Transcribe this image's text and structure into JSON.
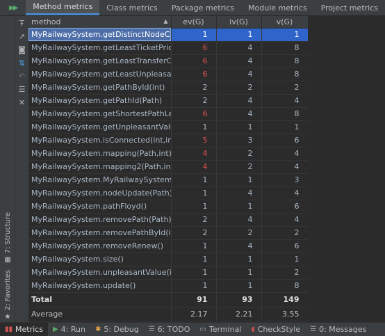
{
  "tabs": [
    {
      "label": "Method metrics",
      "active": true
    },
    {
      "label": "Class metrics",
      "active": false
    },
    {
      "label": "Package metrics",
      "active": false
    },
    {
      "label": "Module metrics",
      "active": false
    },
    {
      "label": "Project metrics",
      "active": false
    }
  ],
  "table": {
    "headers": {
      "method": "method",
      "ev": "ev(G)",
      "iv": "iv(G)",
      "v": "v(G)"
    },
    "rows": [
      {
        "method": "MyRailwaySystem.getDistinctNodeCount",
        "ev": "1",
        "iv": "1",
        "v": "1",
        "ev_red": false
      },
      {
        "method": "MyRailwaySystem.getLeastTicketPrice(int,",
        "ev": "6",
        "iv": "4",
        "v": "8",
        "ev_red": true
      },
      {
        "method": "MyRailwaySystem.getLeastTransferCount",
        "ev": "6",
        "iv": "4",
        "v": "8",
        "ev_red": true
      },
      {
        "method": "MyRailwaySystem.getLeastUnpleasantVal",
        "ev": "6",
        "iv": "4",
        "v": "8",
        "ev_red": true
      },
      {
        "method": "MyRailwaySystem.getPathById(int)",
        "ev": "2",
        "iv": "2",
        "v": "2",
        "ev_red": false
      },
      {
        "method": "MyRailwaySystem.getPathId(Path)",
        "ev": "2",
        "iv": "4",
        "v": "4",
        "ev_red": false
      },
      {
        "method": "MyRailwaySystem.getShortestPathLength",
        "ev": "6",
        "iv": "4",
        "v": "8",
        "ev_red": true
      },
      {
        "method": "MyRailwaySystem.getUnpleasantValue(Pa",
        "ev": "1",
        "iv": "1",
        "v": "1",
        "ev_red": false
      },
      {
        "method": "MyRailwaySystem.isConnected(int,int)",
        "ev": "5",
        "iv": "3",
        "v": "6",
        "ev_red": true
      },
      {
        "method": "MyRailwaySystem.mapping(Path,int)",
        "ev": "4",
        "iv": "2",
        "v": "4",
        "ev_red": true
      },
      {
        "method": "MyRailwaySystem.mapping2(Path,int)",
        "ev": "4",
        "iv": "2",
        "v": "4",
        "ev_red": true
      },
      {
        "method": "MyRailwaySystem.MyRailwaySystem()",
        "ev": "1",
        "iv": "1",
        "v": "3",
        "ev_red": false
      },
      {
        "method": "MyRailwaySystem.nodeUpdate(Path)",
        "ev": "1",
        "iv": "4",
        "v": "4",
        "ev_red": false
      },
      {
        "method": "MyRailwaySystem.pathFloyd()",
        "ev": "1",
        "iv": "1",
        "v": "6",
        "ev_red": false
      },
      {
        "method": "MyRailwaySystem.removePath(Path)",
        "ev": "2",
        "iv": "4",
        "v": "4",
        "ev_red": false
      },
      {
        "method": "MyRailwaySystem.removePathById(int)",
        "ev": "2",
        "iv": "2",
        "v": "2",
        "ev_red": false
      },
      {
        "method": "MyRailwaySystem.removeRenew()",
        "ev": "1",
        "iv": "4",
        "v": "6",
        "ev_red": false
      },
      {
        "method": "MyRailwaySystem.size()",
        "ev": "1",
        "iv": "1",
        "v": "1",
        "ev_red": false
      },
      {
        "method": "MyRailwaySystem.unpleasantValue(int,int)",
        "ev": "1",
        "iv": "1",
        "v": "2",
        "ev_red": false
      },
      {
        "method": "MyRailwaySystem.update()",
        "ev": "1",
        "iv": "1",
        "v": "8",
        "ev_red": false
      }
    ],
    "total": {
      "label": "Total",
      "ev": "91",
      "iv": "93",
      "v": "149"
    },
    "average": {
      "label": "Average",
      "ev": "2.17",
      "iv": "2.21",
      "v": "3.55"
    }
  },
  "left_stripe": {
    "structure": "7: Structure",
    "favorites": "2: Favorites"
  },
  "bottom_tools": [
    {
      "label": "Metrics",
      "icon": "metrics-icon",
      "active": true
    },
    {
      "label": "4: Run",
      "icon": "run-icon",
      "active": false
    },
    {
      "label": "5: Debug",
      "icon": "debug-icon",
      "active": false
    },
    {
      "label": "6: TODO",
      "icon": "todo-icon",
      "active": false
    },
    {
      "label": "Terminal",
      "icon": "terminal-icon",
      "active": false
    },
    {
      "label": "CheckStyle",
      "icon": "checkstyle-icon",
      "active": false
    },
    {
      "label": "0: Messages",
      "icon": "messages-icon",
      "active": false
    }
  ],
  "colors": {
    "accent": "#4a88c7",
    "selection": "#2f65ca",
    "warning_value": "#e05252"
  }
}
